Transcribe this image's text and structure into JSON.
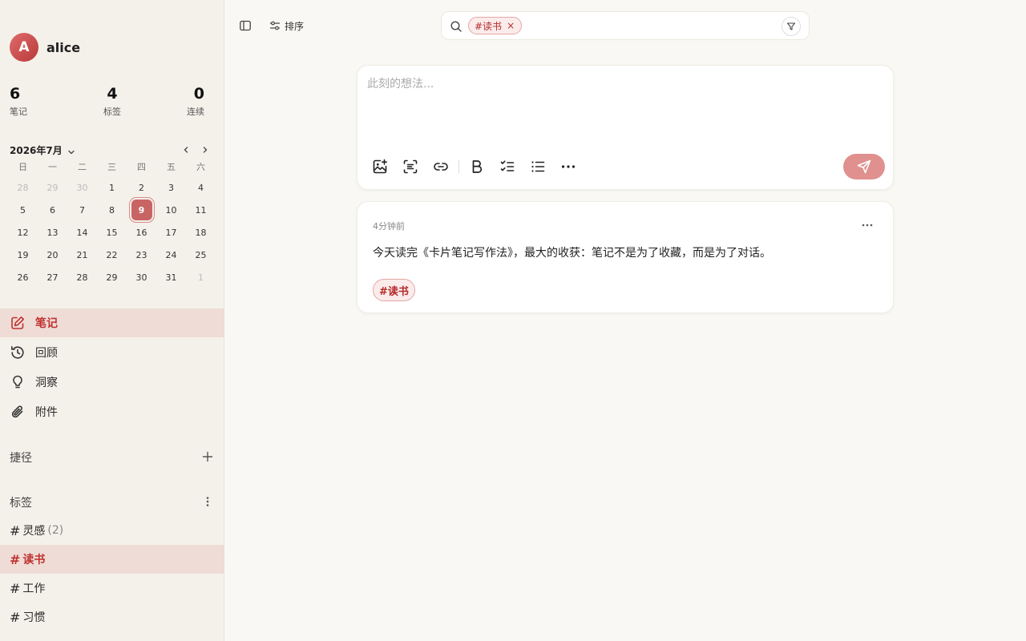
{
  "user": {
    "avatar_letter": "A",
    "name": "alice"
  },
  "stats": [
    {
      "value": "6",
      "label": "笔记"
    },
    {
      "value": "4",
      "label": "标签"
    },
    {
      "value": "0",
      "label": "连续"
    }
  ],
  "calendar": {
    "month_label": "2026年7月",
    "weekdays": [
      "日",
      "一",
      "二",
      "三",
      "四",
      "五",
      "六"
    ],
    "days": [
      {
        "d": "28",
        "muted": true
      },
      {
        "d": "29",
        "muted": true
      },
      {
        "d": "30",
        "muted": true
      },
      {
        "d": "1"
      },
      {
        "d": "2"
      },
      {
        "d": "3"
      },
      {
        "d": "4"
      },
      {
        "d": "5"
      },
      {
        "d": "6"
      },
      {
        "d": "7"
      },
      {
        "d": "8"
      },
      {
        "d": "9",
        "today": true
      },
      {
        "d": "10"
      },
      {
        "d": "11"
      },
      {
        "d": "12"
      },
      {
        "d": "13"
      },
      {
        "d": "14"
      },
      {
        "d": "15"
      },
      {
        "d": "16"
      },
      {
        "d": "17"
      },
      {
        "d": "18"
      },
      {
        "d": "19"
      },
      {
        "d": "20"
      },
      {
        "d": "21"
      },
      {
        "d": "22"
      },
      {
        "d": "23"
      },
      {
        "d": "24"
      },
      {
        "d": "25"
      },
      {
        "d": "26"
      },
      {
        "d": "27"
      },
      {
        "d": "28"
      },
      {
        "d": "29"
      },
      {
        "d": "30"
      },
      {
        "d": "31"
      },
      {
        "d": "1",
        "muted": true
      }
    ]
  },
  "nav": [
    {
      "label": "笔记",
      "icon": "pencil-square-icon",
      "active": true
    },
    {
      "label": "回顾",
      "icon": "history-icon"
    },
    {
      "label": "洞察",
      "icon": "lightbulb-icon"
    },
    {
      "label": "附件",
      "icon": "paperclip-icon"
    }
  ],
  "shortcuts": {
    "title": "捷径"
  },
  "tags_section": {
    "title": "标签",
    "items": [
      {
        "hash": "#",
        "name": "灵感",
        "count": "(2)"
      },
      {
        "hash": "#",
        "name": "读书",
        "active": true
      },
      {
        "hash": "#",
        "name": "工作"
      },
      {
        "hash": "#",
        "name": "习惯"
      }
    ]
  },
  "topbar": {
    "sort_label": "排序"
  },
  "search": {
    "chip_label": "#读书",
    "chip_close": "×"
  },
  "editor": {
    "placeholder": "此刻的想法..."
  },
  "memo": {
    "time": "4分钟前",
    "content": "今天读完《卡片笔记写作法》，最大的收获：笔记不是为了收藏，而是为了对话。",
    "tag": "#读书"
  },
  "colors": {
    "accent": "#c0322f",
    "active_bg": "#efdcd6",
    "send_button": "#e0908e"
  }
}
